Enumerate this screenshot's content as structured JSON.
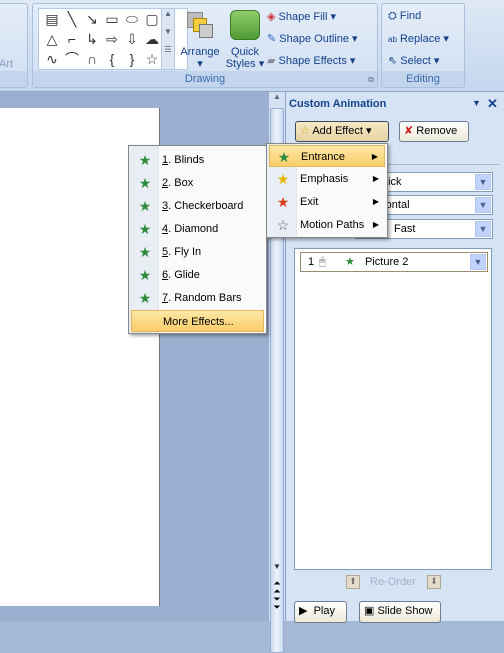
{
  "ribbon": {
    "left_group_partial": "Art",
    "drawing": {
      "label": "Drawing",
      "arrange": "Arrange",
      "quick_styles": "Quick Styles",
      "shape_fill": "Shape Fill",
      "shape_outline": "Shape Outline",
      "shape_effects": "Shape Effects",
      "shapes": [
        "▤",
        "╲",
        "↘",
        "▭",
        "⬭",
        "▢",
        "△",
        "⌐",
        "↳",
        "⇨",
        "⇩",
        "☁",
        "∿",
        "⌒",
        "∩",
        "{",
        "}",
        "☆"
      ]
    },
    "editing": {
      "label": "Editing",
      "find": "Find",
      "replace": "Replace",
      "select": "Select"
    }
  },
  "pane": {
    "title": "Custom Animation",
    "add_effect": "Add Effect",
    "remove": "Remove",
    "start_value": "On Click",
    "direction_value": "Horizontal",
    "speed_value": "Fast",
    "list": [
      {
        "order": "1",
        "name": "Picture 2"
      }
    ],
    "reorder": "Re-Order",
    "play": "Play",
    "slide_show": "Slide Show"
  },
  "effect_menu": [
    {
      "label": "Entrance",
      "icon": "entrance-star-icon",
      "color": "#2e8b3e",
      "highlighted": true
    },
    {
      "label": "Emphasis",
      "icon": "emphasis-star-icon",
      "color": "#e8b400"
    },
    {
      "label": "Exit",
      "icon": "exit-star-icon",
      "color": "#d8401c"
    },
    {
      "label": "Motion Paths",
      "icon": "motion-path-star-icon",
      "color": "#666666"
    }
  ],
  "entrance_menu": [
    {
      "num": "1",
      "label": ". Blinds"
    },
    {
      "num": "2",
      "label": ". Box"
    },
    {
      "num": "3",
      "label": ". Checkerboard"
    },
    {
      "num": "4",
      "label": ". Diamond"
    },
    {
      "num": "5",
      "label": ". Fly In"
    },
    {
      "num": "6",
      "label": ". Glide"
    },
    {
      "num": "7",
      "label": ". Random Bars"
    }
  ],
  "more_effects": "More Effects..."
}
